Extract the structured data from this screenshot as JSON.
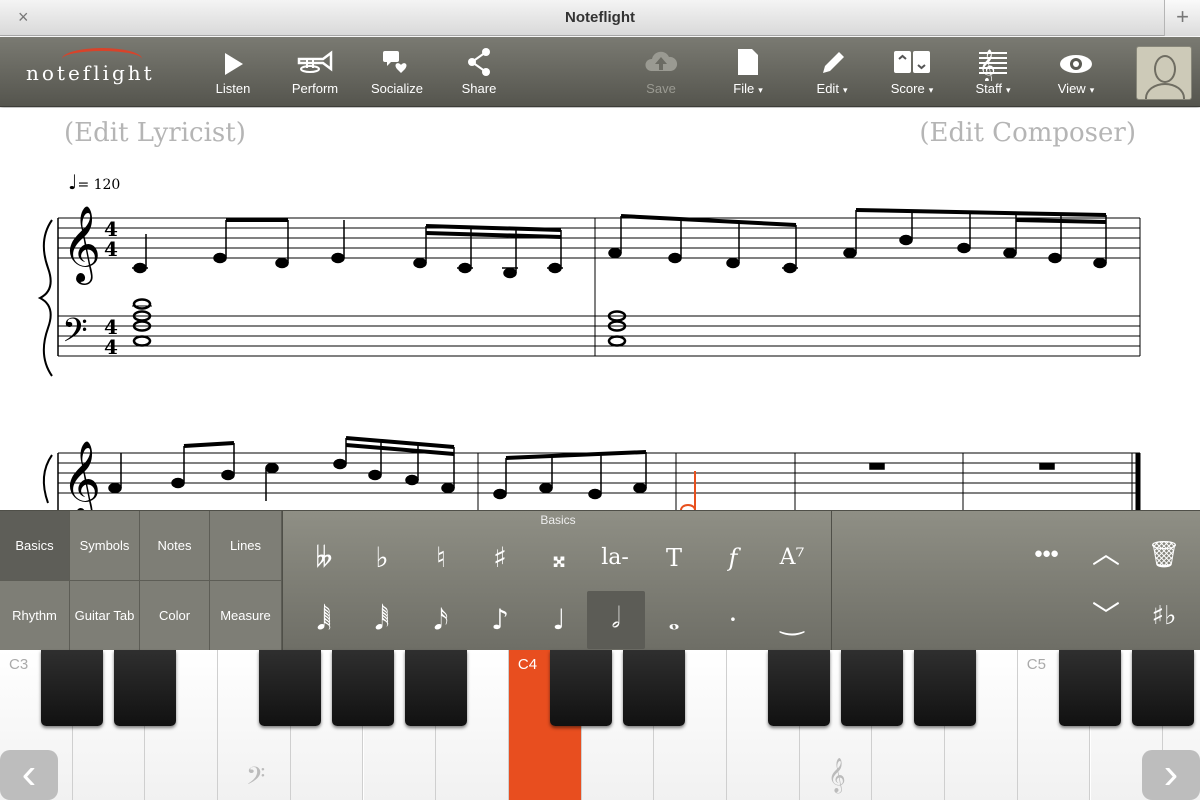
{
  "window": {
    "title": "Noteflight",
    "close_icon": "×",
    "new_tab_icon": "+"
  },
  "logo": {
    "text": "noteflight"
  },
  "toolbar": {
    "left": [
      {
        "id": "listen",
        "label": "Listen",
        "icon": "▶"
      },
      {
        "id": "perform",
        "label": "Perform",
        "icon": "📯"
      },
      {
        "id": "socialize",
        "label": "Socialize",
        "icon": "💬"
      },
      {
        "id": "share",
        "label": "Share",
        "icon": "⤴"
      }
    ],
    "save": {
      "label": "Save",
      "icon": "☁",
      "enabled": false
    },
    "right": [
      {
        "id": "file",
        "label": "File",
        "icon": "▯",
        "dropdown": true
      },
      {
        "id": "edit",
        "label": "Edit",
        "icon": "✎",
        "dropdown": true
      },
      {
        "id": "score",
        "label": "Score",
        "icon": "◫",
        "dropdown": true
      },
      {
        "id": "staff",
        "label": "Staff",
        "icon": "𝄞",
        "dropdown": true
      },
      {
        "id": "view",
        "label": "View",
        "icon": "👁",
        "dropdown": true
      }
    ],
    "caret": "▾"
  },
  "score": {
    "lyricist": "(Edit Lyricist)",
    "composer": "(Edit Composer)",
    "tempo_value": "= 120",
    "tempo_note": "♩",
    "time_signature": "4/4",
    "accent_color": "#e8501e"
  },
  "palette": {
    "title": "Basics",
    "tabs": [
      "Basics",
      "Symbols",
      "Notes",
      "Lines",
      "Rhythm",
      "Guitar Tab",
      "Color",
      "Measure"
    ],
    "active_tab": "Basics",
    "row1": [
      {
        "name": "double-flat",
        "glyph": "𝄫"
      },
      {
        "name": "flat",
        "glyph": "♭"
      },
      {
        "name": "natural",
        "glyph": "♮"
      },
      {
        "name": "sharp",
        "glyph": "♯"
      },
      {
        "name": "double-sharp",
        "glyph": "𝄪"
      },
      {
        "name": "lyric",
        "glyph": "la-"
      },
      {
        "name": "text",
        "glyph": "T"
      },
      {
        "name": "dynamic",
        "glyph": "f"
      },
      {
        "name": "chord",
        "glyph": "A⁷"
      }
    ],
    "row2": [
      {
        "name": "64th-note",
        "glyph": "𝅘𝅥𝅲"
      },
      {
        "name": "32nd-note",
        "glyph": "𝅘𝅥𝅱"
      },
      {
        "name": "16th-note",
        "glyph": "𝅘𝅥𝅯"
      },
      {
        "name": "eighth-note",
        "glyph": "♪"
      },
      {
        "name": "quarter-note",
        "glyph": "♩"
      },
      {
        "name": "half-note",
        "glyph": "𝅗𝅥",
        "selected": true
      },
      {
        "name": "whole-note",
        "glyph": "𝅝"
      },
      {
        "name": "dot",
        "glyph": "·"
      },
      {
        "name": "tie",
        "glyph": "‿"
      }
    ],
    "controls": {
      "more": "●●●",
      "up": "︿",
      "down": "﹀",
      "delete": "🗑",
      "enharmonic": "♯♭"
    }
  },
  "keyboard": {
    "labels": {
      "c3": "C3",
      "c4": "C4",
      "c5": "C5"
    },
    "active_key": "C4",
    "bass_clef": "𝄢",
    "treble_clef": "𝄞",
    "prev_icon": "‹",
    "next_icon": "›"
  }
}
